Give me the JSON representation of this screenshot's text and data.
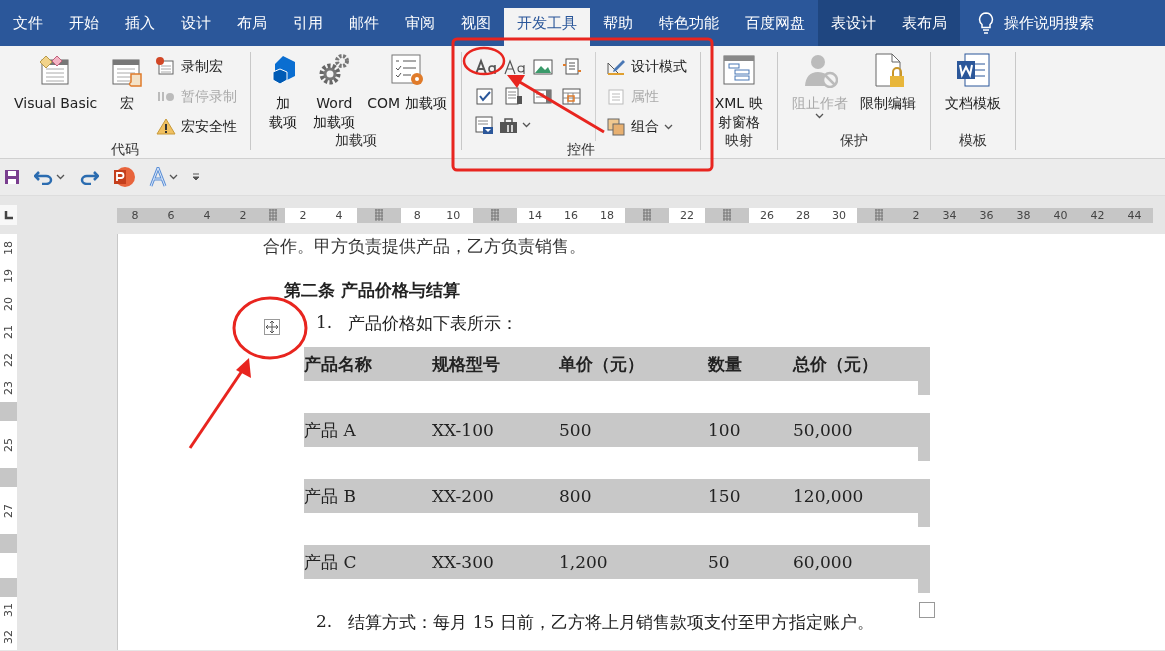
{
  "tabs": [
    {
      "label": "文件",
      "selected": false,
      "contextual": false
    },
    {
      "label": "开始",
      "selected": false,
      "contextual": false
    },
    {
      "label": "插入",
      "selected": false,
      "contextual": false
    },
    {
      "label": "设计",
      "selected": false,
      "contextual": false
    },
    {
      "label": "布局",
      "selected": false,
      "contextual": false
    },
    {
      "label": "引用",
      "selected": false,
      "contextual": false
    },
    {
      "label": "邮件",
      "selected": false,
      "contextual": false
    },
    {
      "label": "审阅",
      "selected": false,
      "contextual": false
    },
    {
      "label": "视图",
      "selected": false,
      "contextual": false
    },
    {
      "label": "开发工具",
      "selected": true,
      "contextual": false
    },
    {
      "label": "帮助",
      "selected": false,
      "contextual": false
    },
    {
      "label": "特色功能",
      "selected": false,
      "contextual": false
    },
    {
      "label": "百度网盘",
      "selected": false,
      "contextual": false
    },
    {
      "label": "表设计",
      "selected": false,
      "contextual": true
    },
    {
      "label": "表布局",
      "selected": false,
      "contextual": true
    }
  ],
  "tell_me": {
    "label": "操作说明搜索"
  },
  "ribbon_groups": [
    {
      "title": "代码",
      "items": [
        {
          "kind": "large",
          "lines": [
            "Visual Basic"
          ],
          "disabled": false,
          "dropdown": false
        },
        {
          "kind": "large",
          "lines": [
            "宏"
          ],
          "disabled": false,
          "dropdown": false
        },
        {
          "kind": "stack",
          "buttons": [
            {
              "label": "录制宏",
              "disabled": false,
              "dropdown": false
            },
            {
              "label": "暂停录制",
              "disabled": true,
              "dropdown": false
            },
            {
              "label": "宏安全性",
              "disabled": false,
              "dropdown": false
            }
          ]
        }
      ]
    },
    {
      "title": "加载项",
      "items": [
        {
          "kind": "large",
          "lines": [
            "加",
            "载项"
          ],
          "disabled": false,
          "dropdown": false
        },
        {
          "kind": "large",
          "lines": [
            "Word",
            "加载项"
          ],
          "disabled": false,
          "dropdown": false
        },
        {
          "kind": "large",
          "lines": [
            "COM 加载项"
          ],
          "disabled": false,
          "dropdown": false
        }
      ]
    },
    {
      "title": "控件",
      "items": [
        {
          "kind": "gallery"
        },
        {
          "kind": "stack",
          "buttons": [
            {
              "label": "设计模式",
              "disabled": false,
              "dropdown": false
            },
            {
              "label": "属性",
              "disabled": true,
              "dropdown": false
            },
            {
              "label": "组合",
              "disabled": false,
              "dropdown": true
            }
          ]
        }
      ]
    },
    {
      "title": "映射",
      "items": [
        {
          "kind": "large",
          "lines": [
            "XML 映",
            "射窗格"
          ],
          "disabled": false,
          "dropdown": false
        }
      ]
    },
    {
      "title": "保护",
      "items": [
        {
          "kind": "large",
          "lines": [
            "阻止作者"
          ],
          "disabled": true,
          "dropdown": true
        },
        {
          "kind": "large",
          "lines": [
            "限制编辑"
          ],
          "disabled": false,
          "dropdown": false
        }
      ]
    },
    {
      "title": "模板",
      "items": [
        {
          "kind": "large",
          "lines": [
            "文档模板"
          ],
          "disabled": false,
          "dropdown": false
        }
      ]
    }
  ],
  "ruler": [
    {
      "kind": "margin",
      "labels": [
        "8",
        "6",
        "4",
        "2"
      ]
    },
    {
      "kind": "marker"
    },
    {
      "kind": "text",
      "labels": [
        "2",
        "4"
      ]
    },
    {
      "kind": "marker"
    },
    {
      "kind": "text",
      "labels": [
        "8",
        "10"
      ]
    },
    {
      "kind": "marker"
    },
    {
      "kind": "text",
      "labels": [
        "14",
        "16",
        "18"
      ]
    },
    {
      "kind": "marker"
    },
    {
      "kind": "text",
      "labels": [
        "22"
      ]
    },
    {
      "kind": "marker"
    },
    {
      "kind": "text",
      "labels": [
        "26",
        "28",
        "30"
      ]
    },
    {
      "kind": "marker"
    },
    {
      "kind": "margin",
      "labels": [
        "2",
        "34",
        "36",
        "38",
        "40",
        "42",
        "44"
      ]
    }
  ],
  "vertical_ruler": [
    {
      "kind": "text",
      "labels": [
        "18",
        "19",
        "20",
        "21",
        "22",
        "23"
      ]
    },
    {
      "kind": "marker"
    },
    {
      "kind": "text",
      "labels": [
        "25"
      ]
    },
    {
      "kind": "marker"
    },
    {
      "kind": "text",
      "labels": [
        "27"
      ]
    },
    {
      "kind": "marker"
    },
    {
      "kind": "text"
    },
    {
      "kind": "marker"
    },
    {
      "kind": "text",
      "labels": [
        "31",
        "32"
      ]
    }
  ],
  "document": {
    "cut_line": "合作。甲方负责提供产品，乙方负责销售。",
    "heading": "第二条  产品价格与结算",
    "items": [
      {
        "number": "1.",
        "text": "产品价格如下表所示："
      }
    ],
    "table": {
      "columns": [
        "产品名称",
        "规格型号",
        "单价（元）",
        "数量",
        "总价（元）"
      ],
      "rows": [
        [
          "产品 A",
          "XX-100",
          "500",
          "100",
          "50,000"
        ],
        [
          "产品 B",
          "XX-200",
          "800",
          "150",
          "120,000"
        ],
        [
          "产品 C",
          "XX-300",
          "1,200",
          "50",
          "60,000"
        ]
      ]
    },
    "after_items": [
      {
        "number": "2.",
        "text": "结算方式：每月 15 日前，乙方将上月销售款项支付至甲方指定账户。"
      }
    ]
  }
}
